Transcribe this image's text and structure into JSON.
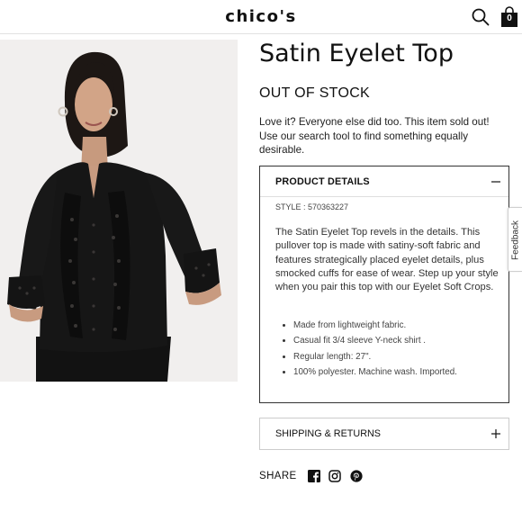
{
  "header": {
    "logo": "chico's",
    "search_icon": "search-icon",
    "bag_icon": "shopping-bag-icon",
    "bag_count": "0"
  },
  "product": {
    "title": "Satin Eyelet Top",
    "availability": "OUT OF STOCK",
    "sold_out_message": "Love it? Everyone else did too. This item sold out! Use our search tool to find something equally desirable."
  },
  "details": {
    "heading": "PRODUCT DETAILS",
    "collapse_icon": "minus-icon",
    "style": "STYLE : 570363227",
    "description": "The Satin Eyelet Top revels in the details. This pullover top is made with satiny-soft fabric and features strategically placed eyelet details, plus smocked cuffs for ease of wear. Step up your style when you pair this top with our Eyelet Soft Crops.",
    "bullets": [
      "Made from lightweight fabric.",
      "Casual fit 3/4 sleeve Y-neck shirt .",
      "Regular length: 27\".",
      "100% polyester. Machine wash. Imported."
    ]
  },
  "shipping": {
    "heading": "SHIPPING & RETURNS",
    "expand_icon": "plus-icon"
  },
  "share": {
    "label": "SHARE",
    "icons": [
      "facebook-icon",
      "instagram-icon",
      "pinterest-icon"
    ]
  },
  "feedback": {
    "label": "Feedback"
  },
  "colors": {
    "text": "#111111",
    "border": "#333333",
    "photo_background": "#f1efee",
    "garment": "#161616"
  }
}
